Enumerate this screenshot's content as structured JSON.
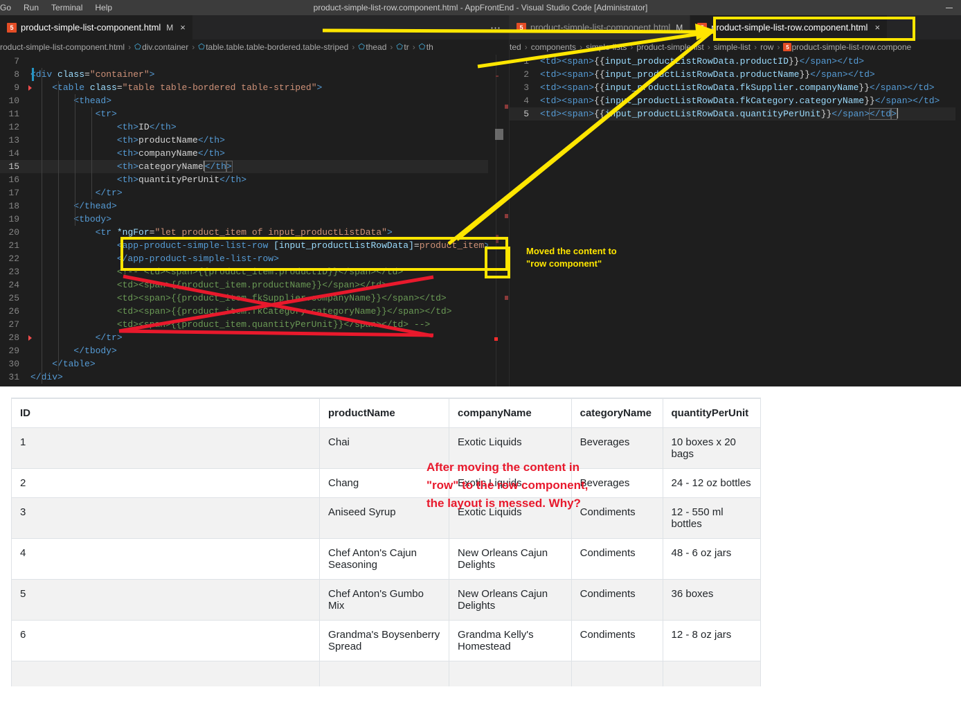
{
  "window": {
    "title": "product-simple-list-row.component.html - AppFrontEnd - Visual Studio Code [Administrator]",
    "minimize_label": "—"
  },
  "menubar": {
    "items": [
      "Go",
      "Run",
      "Terminal",
      "Help"
    ]
  },
  "editor_left": {
    "tab": {
      "label": "product-simple-list-component.html",
      "dirty": "M",
      "close": "×",
      "icon": "html5-file-icon"
    },
    "tabbar_more": "⋯",
    "breadcrumb": [
      "roduct-simple-list-component.html",
      "div.container",
      "table.table.table-bordered.table-striped",
      "thead",
      "tr",
      "th"
    ],
    "first_line_number": 7,
    "active_line": 15,
    "lines": [
      {
        "n": 7,
        "text": ""
      },
      {
        "n": 8,
        "text": "<div class=\"container\">"
      },
      {
        "n": 9,
        "text": "    <table class=\"table table-bordered table-striped\">"
      },
      {
        "n": 10,
        "text": "        <thead>"
      },
      {
        "n": 11,
        "text": "            <tr>"
      },
      {
        "n": 12,
        "text": "                <th>ID</th>"
      },
      {
        "n": 13,
        "text": "                <th>productName</th>"
      },
      {
        "n": 14,
        "text": "                <th>companyName</th>"
      },
      {
        "n": 15,
        "text": "                <th>categoryName</th>"
      },
      {
        "n": 16,
        "text": "                <th>quantityPerUnit</th>"
      },
      {
        "n": 17,
        "text": "            </tr>"
      },
      {
        "n": 18,
        "text": "        </thead>"
      },
      {
        "n": 19,
        "text": "        <tbody>"
      },
      {
        "n": 20,
        "text": "            <tr *ngFor=\"let product_item of input_productListData\">"
      },
      {
        "n": 21,
        "text": "                <app-product-simple-list-row [input_productListRowData]=product_item>"
      },
      {
        "n": 22,
        "text": "                </app-product-simple-list-row>"
      },
      {
        "n": 23,
        "text": "                <!-- <td><span>{{product_item.productID}}</span></td>"
      },
      {
        "n": 24,
        "text": "                <td><span>{{product_item.productName}}</span></td>"
      },
      {
        "n": 25,
        "text": "                <td><span>{{product_item.fkSupplier.companyName}}</span></td>"
      },
      {
        "n": 26,
        "text": "                <td><span>{{product_item.fkCategory.categoryName}}</span></td>"
      },
      {
        "n": 27,
        "text": "                <td><span>{{product_item.quantityPerUnit}}</span></td> -->"
      },
      {
        "n": 28,
        "text": "            </tr>"
      },
      {
        "n": 29,
        "text": "        </tbody>"
      },
      {
        "n": 30,
        "text": "    </table>"
      },
      {
        "n": 31,
        "text": "</div>"
      }
    ]
  },
  "editor_right": {
    "tabs": [
      {
        "label": "product-simple-list-component.html",
        "dirty": "M",
        "active": false,
        "icon": "html5-file-icon"
      },
      {
        "label": "product-simple-list-row.component.html",
        "dirty": "",
        "active": true,
        "close": "×",
        "icon": "html5-file-icon"
      }
    ],
    "breadcrumb": [
      "ted",
      "components",
      "simple-lists",
      "product-simple-list",
      "simple-list",
      "row",
      "product-simple-list-row.compone"
    ],
    "active_line": 5,
    "lines": [
      {
        "n": 1,
        "text": "<td><span>{{input_productListRowData.productID}}</span></td>"
      },
      {
        "n": 2,
        "text": "<td><span>{{input_productListRowData.productName}}</span></td>"
      },
      {
        "n": 3,
        "text": "<td><span>{{input_productListRowData.fkSupplier.companyName}}</span></td>"
      },
      {
        "n": 4,
        "text": "<td><span>{{input_productListRowData.fkCategory.categoryName}}</span></td>"
      },
      {
        "n": 5,
        "text": "<td><span>{{input_productListRowData.quantityPerUnit}}</span></td>"
      }
    ]
  },
  "annotations": {
    "yellow_note": "Moved the content to\n\"row component\"",
    "red_note": "After moving the content in\n\"row\" to the row component,\nthe layout is messed. Why?",
    "highlight_color": "#ffe600",
    "strike_color": "#e8192c"
  },
  "table": {
    "headers": [
      "ID",
      "productName",
      "companyName",
      "categoryName",
      "quantityPerUnit"
    ],
    "rows": [
      {
        "id": "1",
        "productName": "Chai",
        "companyName": "Exotic Liquids",
        "categoryName": "Beverages",
        "quantityPerUnit": "10 boxes x 20 bags"
      },
      {
        "id": "2",
        "productName": "Chang",
        "companyName": "Exotic Liquids",
        "categoryName": "Beverages",
        "quantityPerUnit": "24 - 12 oz bottles"
      },
      {
        "id": "3",
        "productName": "Aniseed Syrup",
        "companyName": "Exotic Liquids",
        "categoryName": "Condiments",
        "quantityPerUnit": "12 - 550 ml bottles"
      },
      {
        "id": "4",
        "productName": "Chef Anton's Cajun Seasoning",
        "companyName": "New Orleans Cajun Delights",
        "categoryName": "Condiments",
        "quantityPerUnit": "48 - 6 oz jars"
      },
      {
        "id": "5",
        "productName": "Chef Anton's Gumbo Mix",
        "companyName": "New Orleans Cajun Delights",
        "categoryName": "Condiments",
        "quantityPerUnit": "36 boxes"
      },
      {
        "id": "6",
        "productName": "Grandma's Boysenberry Spread",
        "companyName": "Grandma Kelly's Homestead",
        "categoryName": "Condiments",
        "quantityPerUnit": "12 - 8 oz jars"
      },
      {
        "id": "",
        "productName": "",
        "companyName": "",
        "categoryName": "",
        "quantityPerUnit": ""
      }
    ]
  },
  "colors": {
    "editor_bg": "#1e1e1e",
    "titlebar_bg": "#3c3c3c",
    "tab_inactive_bg": "#2d2d2d",
    "accent_yellow": "#ffe600",
    "accent_red": "#e8192c",
    "table_border": "#dee2e6",
    "table_stripe": "#f2f2f2"
  }
}
